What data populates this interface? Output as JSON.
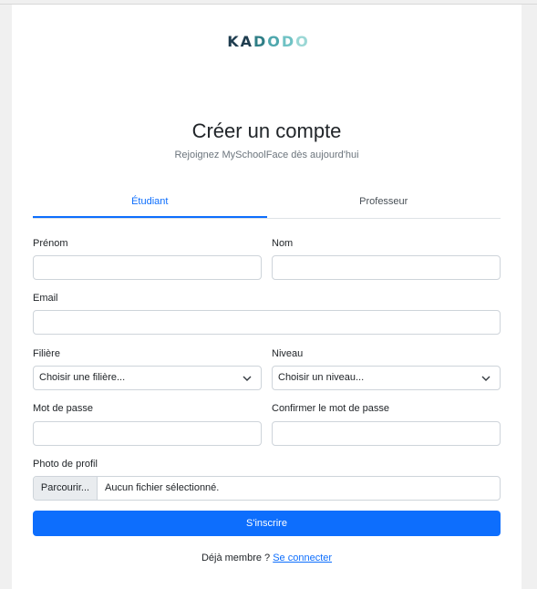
{
  "brand": {
    "logo_letters": [
      "K",
      "A",
      "D",
      "O",
      "D",
      "O"
    ]
  },
  "header": {
    "title": "Créer un compte",
    "subtitle": "Rejoignez MySchoolFace dès aujourd'hui"
  },
  "tabs": [
    {
      "label": "Étudiant",
      "active": true
    },
    {
      "label": "Professeur",
      "active": false
    }
  ],
  "form": {
    "first_name": {
      "label": "Prénom",
      "value": ""
    },
    "last_name": {
      "label": "Nom",
      "value": ""
    },
    "email": {
      "label": "Email",
      "value": ""
    },
    "field_of_study": {
      "label": "Filière",
      "selected": "Choisir une filière..."
    },
    "level": {
      "label": "Niveau",
      "selected": "Choisir un niveau..."
    },
    "password": {
      "label": "Mot de passe",
      "value": ""
    },
    "confirm_password": {
      "label": "Confirmer le mot de passe",
      "value": ""
    },
    "photo": {
      "label": "Photo de profil",
      "button": "Parcourir...",
      "status": "Aucun fichier sélectionné."
    },
    "submit_label": "S'inscrire"
  },
  "footer": {
    "prompt": "Déjà membre ?",
    "link": "Se connecter"
  },
  "colors": {
    "accent": "#0d6efd",
    "logo_dark": "#1f3d4f",
    "logo_teal": "#4ea7ad"
  }
}
